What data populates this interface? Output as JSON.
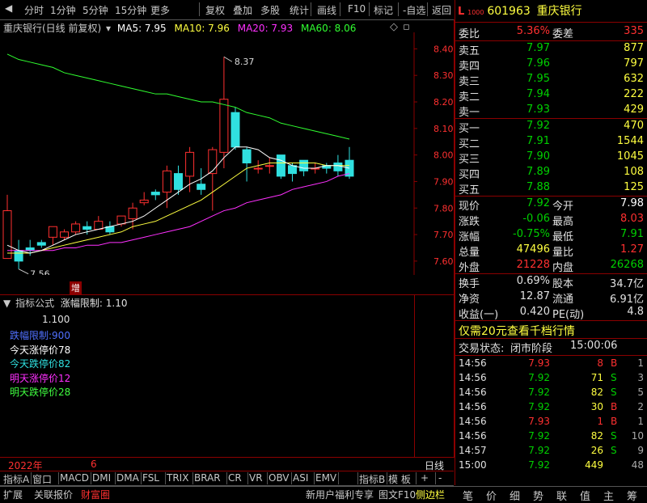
{
  "toolbar": {
    "items": [
      "分时",
      "1分钟",
      "5分钟",
      "15分钟",
      "更多",
      "复权",
      "叠加",
      "多股",
      "统计",
      "画线",
      "F10",
      "标记",
      "-自选",
      "返回"
    ]
  },
  "chart_header": {
    "title": "重庆银行(日线 前复权)",
    "ma5": "MA5: 7.95",
    "ma10": "MA10: 7.96",
    "ma20": "MA20: 7.93",
    "ma60": "MA60: 8.06"
  },
  "high_label": "8.37",
  "low_label": "7.56",
  "zeng_label": "增",
  "indicator_header": {
    "name": "指标公式",
    "param": "涨幅限制: 1.10"
  },
  "indicator_value": "1.100",
  "indicator_lines": [
    {
      "text": "跌幅限制:900",
      "color": "#5070ff"
    },
    {
      "text": "今天涨停价78",
      "color": "#ffffff"
    },
    {
      "text": "今天跌停价82",
      "color": "#30e0e0"
    },
    {
      "text": "明天涨停价12",
      "color": "#ff30ff"
    },
    {
      "text": "明天跌停价28",
      "color": "#40ff40"
    }
  ],
  "x_axis": {
    "year": "2022年",
    "month": "6"
  },
  "day_line_label": "日线",
  "tabs_bottom": [
    "指标A",
    "窗口",
    "MACD",
    "DMI",
    "DMA",
    "FSL",
    "TRIX",
    "BRAR",
    "CR",
    "VR",
    "OBV",
    "ASI",
    "EMV",
    "指标B",
    "模 板",
    "+",
    "-"
  ],
  "status_bar": {
    "left": [
      "扩展",
      "关联报价",
      "财富圈"
    ],
    "right": [
      "新用户福利专享",
      "图文F10",
      "侧边栏"
    ],
    "nav": [
      "笔",
      "价",
      "细",
      "势",
      "联",
      "值",
      "主",
      "筹"
    ]
  },
  "quote": {
    "tag": "L",
    "sub": "1000",
    "code": "601963",
    "name": "重庆银行",
    "weibi_label": "委比",
    "weibi": "5.36%",
    "weicha_label": "委差",
    "weicha": "335",
    "asks": [
      {
        "label": "卖五",
        "price": "7.97",
        "vol": "877"
      },
      {
        "label": "卖四",
        "price": "7.96",
        "vol": "797"
      },
      {
        "label": "卖三",
        "price": "7.95",
        "vol": "632"
      },
      {
        "label": "卖二",
        "price": "7.94",
        "vol": "222"
      },
      {
        "label": "卖一",
        "price": "7.93",
        "vol": "429"
      }
    ],
    "bids": [
      {
        "label": "买一",
        "price": "7.92",
        "vol": "470"
      },
      {
        "label": "买二",
        "price": "7.91",
        "vol": "1544"
      },
      {
        "label": "买三",
        "price": "7.90",
        "vol": "1045"
      },
      {
        "label": "买四",
        "price": "7.89",
        "vol": "108"
      },
      {
        "label": "买五",
        "price": "7.88",
        "vol": "125"
      }
    ],
    "stats": [
      {
        "l1": "现价",
        "v1": "7.92",
        "c1": "#00d000",
        "l2": "今开",
        "v2": "7.98",
        "c2": "#ffffff"
      },
      {
        "l1": "涨跌",
        "v1": "-0.06",
        "c1": "#00d000",
        "l2": "最高",
        "v2": "8.03",
        "c2": "#ff3030"
      },
      {
        "l1": "涨幅",
        "v1": "-0.75%",
        "c1": "#00d000",
        "l2": "最低",
        "v2": "7.91",
        "c2": "#00d000"
      },
      {
        "l1": "总量",
        "v1": "47496",
        "c1": "#ffff40",
        "l2": "量比",
        "v2": "1.27",
        "c2": "#ff3030"
      },
      {
        "l1": "外盘",
        "v1": "21228",
        "c1": "#ff3030",
        "l2": "内盘",
        "v2": "26268",
        "c2": "#00d000"
      }
    ],
    "stats2": [
      {
        "l1": "换手",
        "v1": "0.69%",
        "l2": "股本",
        "v2": "34.7亿"
      },
      {
        "l1": "净资",
        "v1": "12.87",
        "l2": "流通",
        "v2": "6.91亿"
      },
      {
        "l1": "收益(一)",
        "v1": "0.420",
        "l2": "PE(动)",
        "v2": "4.8"
      }
    ],
    "ad": "仅需20元查看千档行情",
    "trade_status_label": "交易状态:",
    "trade_status": "闭市阶段",
    "trade_time": "15:00:06",
    "ticks": [
      {
        "t": "14:56",
        "p": "7.93",
        "pc": "#ff3030",
        "v": "8",
        "vc": "#ff3030",
        "s": "B",
        "sc": "#ff3030",
        "n": "1"
      },
      {
        "t": "14:56",
        "p": "7.92",
        "pc": "#00d000",
        "v": "71",
        "vc": "#ffff40",
        "s": "S",
        "sc": "#00d000",
        "n": "3"
      },
      {
        "t": "14:56",
        "p": "7.92",
        "pc": "#00d000",
        "v": "82",
        "vc": "#ffff40",
        "s": "S",
        "sc": "#00d000",
        "n": "5"
      },
      {
        "t": "14:56",
        "p": "7.92",
        "pc": "#00d000",
        "v": "30",
        "vc": "#ffff40",
        "s": "B",
        "sc": "#ff3030",
        "n": "2"
      },
      {
        "t": "14:56",
        "p": "7.93",
        "pc": "#ff3030",
        "v": "1",
        "vc": "#ff3030",
        "s": "B",
        "sc": "#ff3030",
        "n": "1"
      },
      {
        "t": "14:56",
        "p": "7.92",
        "pc": "#00d000",
        "v": "82",
        "vc": "#ffff40",
        "s": "S",
        "sc": "#00d000",
        "n": "10"
      },
      {
        "t": "14:57",
        "p": "7.92",
        "pc": "#00d000",
        "v": "26",
        "vc": "#ffff40",
        "s": "S",
        "sc": "#00d000",
        "n": "9"
      },
      {
        "t": "15:00",
        "p": "7.92",
        "pc": "#00d000",
        "v": "449",
        "vc": "#ffff40",
        "s": "",
        "sc": "#00d000",
        "n": "48"
      }
    ]
  },
  "chart_data": {
    "type": "candlestick",
    "title": "重庆银行(日线 前复权)",
    "ylim": [
      7.56,
      8.45
    ],
    "yticks": [
      7.6,
      7.7,
      7.8,
      7.9,
      8.0,
      8.1,
      8.2,
      8.3,
      8.4
    ],
    "candles": [
      {
        "o": 7.61,
        "h": 7.85,
        "l": 7.61,
        "c": 7.79
      },
      {
        "o": 7.64,
        "h": 7.68,
        "l": 7.57,
        "c": 7.6
      },
      {
        "o": 7.65,
        "h": 7.68,
        "l": 7.62,
        "c": 7.64
      },
      {
        "o": 7.67,
        "h": 7.68,
        "l": 7.65,
        "c": 7.66
      },
      {
        "o": 7.69,
        "h": 7.73,
        "l": 7.66,
        "c": 7.73
      },
      {
        "o": 7.69,
        "h": 7.72,
        "l": 7.68,
        "c": 7.71
      },
      {
        "o": 7.71,
        "h": 7.75,
        "l": 7.7,
        "c": 7.74
      },
      {
        "o": 7.73,
        "h": 7.75,
        "l": 7.7,
        "c": 7.72
      },
      {
        "o": 7.72,
        "h": 7.77,
        "l": 7.72,
        "c": 7.75
      },
      {
        "o": 7.73,
        "h": 7.75,
        "l": 7.7,
        "c": 7.71
      },
      {
        "o": 7.74,
        "h": 7.77,
        "l": 7.73,
        "c": 7.77
      },
      {
        "o": 7.76,
        "h": 7.82,
        "l": 7.72,
        "c": 7.8
      },
      {
        "o": 7.82,
        "h": 7.86,
        "l": 7.81,
        "c": 7.83
      },
      {
        "o": 7.86,
        "h": 7.87,
        "l": 7.83,
        "c": 7.85
      },
      {
        "o": 7.86,
        "h": 7.96,
        "l": 7.8,
        "c": 7.94
      },
      {
        "o": 7.93,
        "h": 7.96,
        "l": 7.85,
        "c": 7.87
      },
      {
        "o": 7.92,
        "h": 8.03,
        "l": 7.86,
        "c": 8.01
      },
      {
        "o": 7.89,
        "h": 7.95,
        "l": 7.85,
        "c": 7.87
      },
      {
        "o": 7.93,
        "h": 8.03,
        "l": 7.79,
        "c": 8.02
      },
      {
        "o": 8.01,
        "h": 8.37,
        "l": 7.95,
        "c": 8.21
      },
      {
        "o": 8.16,
        "h": 8.18,
        "l": 8.02,
        "c": 8.03
      },
      {
        "o": 8.02,
        "h": 8.03,
        "l": 7.9,
        "c": 7.97
      },
      {
        "o": 7.95,
        "h": 7.98,
        "l": 7.93,
        "c": 7.95
      },
      {
        "o": 7.96,
        "h": 7.99,
        "l": 7.93,
        "c": 7.96
      },
      {
        "o": 8.0,
        "h": 8.0,
        "l": 7.91,
        "c": 7.92
      },
      {
        "o": 7.96,
        "h": 7.97,
        "l": 7.9,
        "c": 7.93
      },
      {
        "o": 7.98,
        "h": 7.98,
        "l": 7.92,
        "c": 7.94
      },
      {
        "o": 7.95,
        "h": 7.97,
        "l": 7.93,
        "c": 7.95
      },
      {
        "o": 7.96,
        "h": 7.97,
        "l": 7.93,
        "c": 7.95
      },
      {
        "o": 7.97,
        "h": 8.0,
        "l": 7.92,
        "c": 7.94
      },
      {
        "o": 7.98,
        "h": 8.03,
        "l": 7.91,
        "c": 7.92
      }
    ],
    "ma5": [
      7.66,
      7.64,
      7.63,
      7.64,
      7.66,
      7.68,
      7.7,
      7.71,
      7.72,
      7.73,
      7.74,
      7.75,
      7.77,
      7.8,
      7.83,
      7.86,
      7.89,
      7.91,
      7.94,
      7.99,
      8.03,
      8.03,
      8.02,
      7.99,
      7.98,
      7.96,
      7.95,
      7.95,
      7.96,
      7.96,
      7.95
    ],
    "ma10": [
      7.63,
      7.63,
      7.63,
      7.64,
      7.65,
      7.66,
      7.67,
      7.68,
      7.69,
      7.7,
      7.71,
      7.73,
      7.74,
      7.75,
      7.77,
      7.79,
      7.81,
      7.83,
      7.86,
      7.89,
      7.92,
      7.95,
      7.96,
      7.97,
      7.97,
      7.97,
      7.97,
      7.97,
      7.96,
      7.96,
      7.96
    ],
    "ma20": [
      7.64,
      7.64,
      7.64,
      7.64,
      7.64,
      7.65,
      7.65,
      7.66,
      7.66,
      7.67,
      7.67,
      7.68,
      7.69,
      7.7,
      7.71,
      7.72,
      7.73,
      7.75,
      7.77,
      7.79,
      7.8,
      7.82,
      7.83,
      7.84,
      7.85,
      7.87,
      7.88,
      7.89,
      7.9,
      7.92,
      7.93
    ],
    "ma60": [
      8.38,
      8.36,
      8.35,
      8.34,
      8.33,
      8.31,
      8.3,
      8.29,
      8.28,
      8.27,
      8.26,
      8.25,
      8.24,
      8.23,
      8.23,
      8.22,
      8.21,
      8.2,
      8.2,
      8.19,
      8.18,
      8.16,
      8.15,
      8.14,
      8.12,
      8.11,
      8.1,
      8.09,
      8.08,
      8.07,
      8.06
    ],
    "colors": {
      "up": "#ff3030",
      "down": "#30e0e0",
      "ma5": "#ffffff",
      "ma10": "#ffff40",
      "ma20": "#ff30ff",
      "ma60": "#30ff30"
    }
  }
}
